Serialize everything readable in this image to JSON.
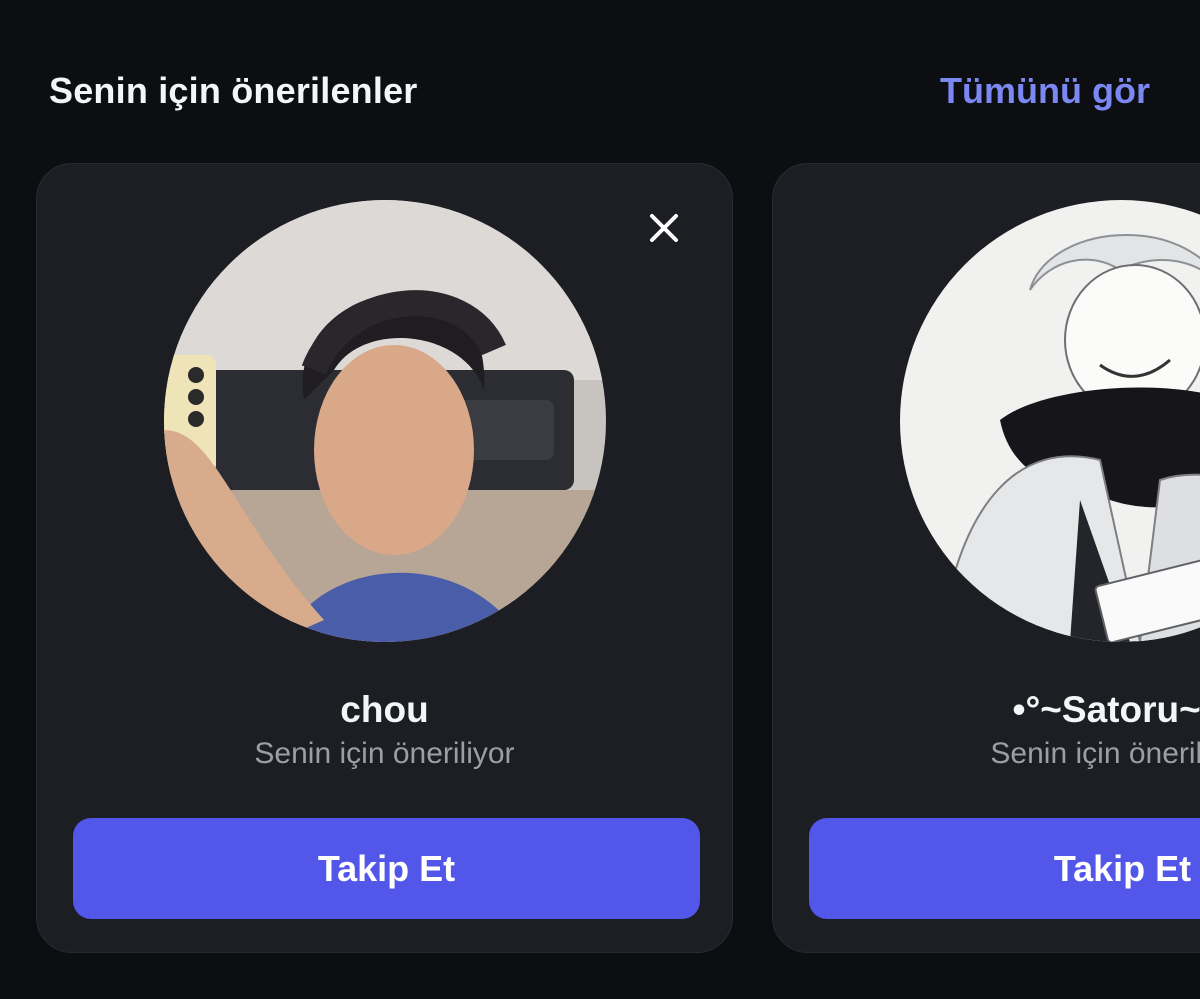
{
  "header": {
    "title": "Senin için önerilenler",
    "see_all_label": "Tümünü gör"
  },
  "suggestions": [
    {
      "name": "chou",
      "subtitle": "Senin için öneriliyor",
      "follow_label": "Takip Et"
    },
    {
      "name": "•°~Satoru~°•",
      "subtitle": "Senin için öneriliyor",
      "follow_label": "Takip Et"
    }
  ],
  "colors": {
    "background": "#0c0e12",
    "card": "#1d1e23",
    "accent_button": "#5257ea",
    "link": "#7b88f2",
    "subtitle": "#9c9ea7"
  },
  "icons": {
    "dismiss": "close-icon"
  }
}
